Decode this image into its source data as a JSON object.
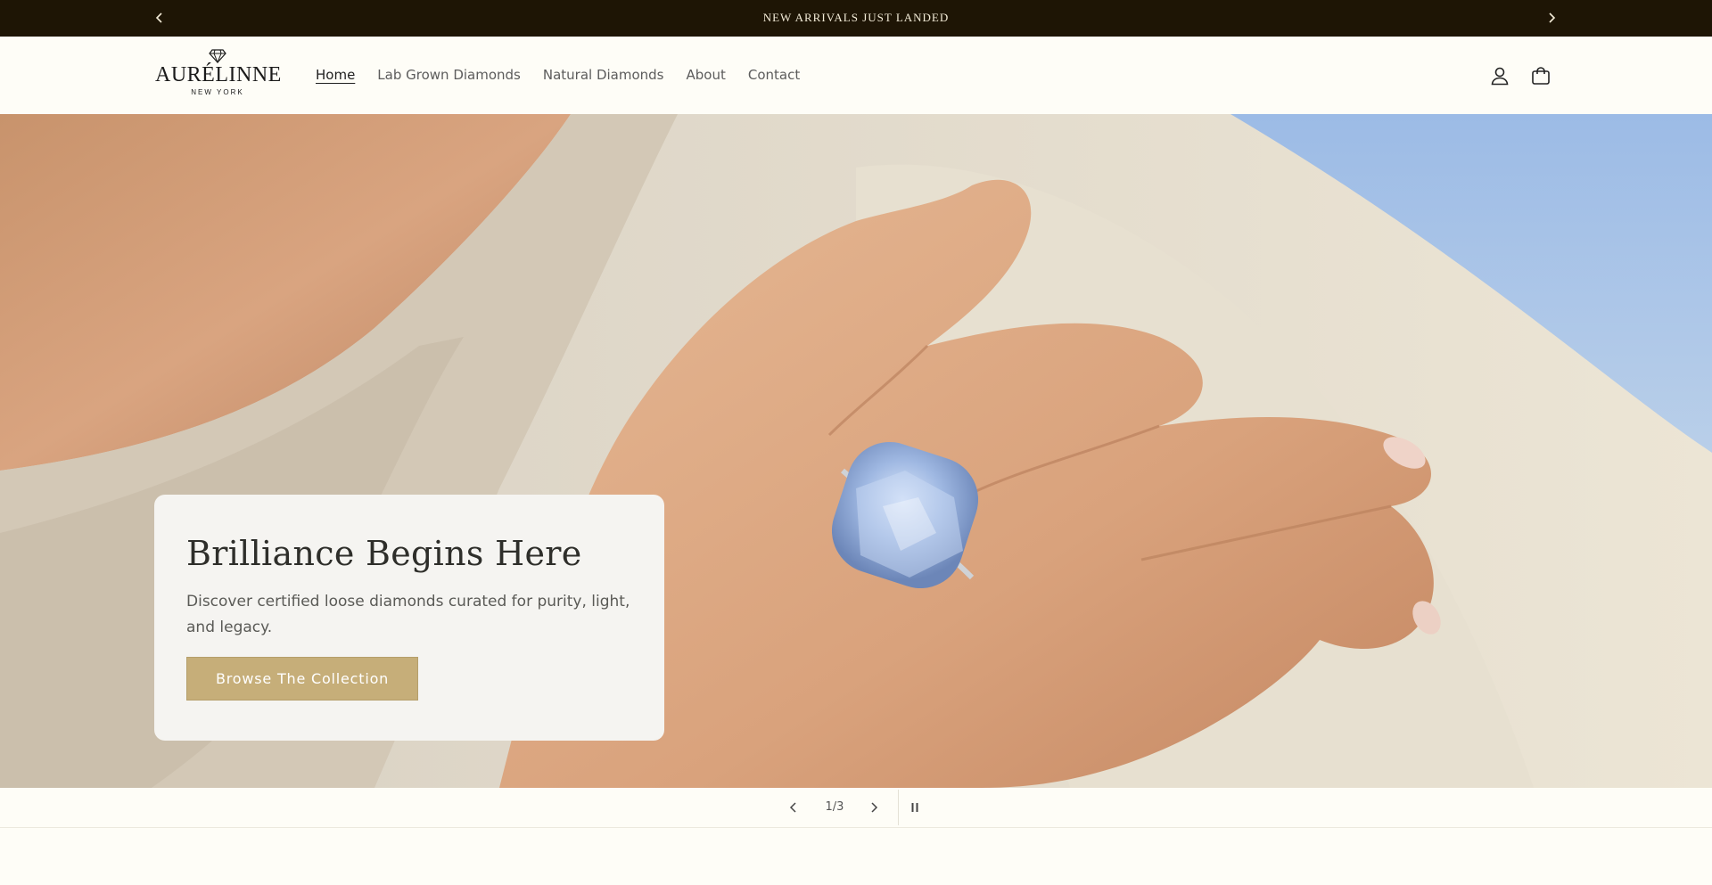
{
  "announcement": {
    "message": "NEW ARRIVALS JUST LANDED",
    "prev_icon": "chevron-left-icon",
    "next_icon": "chevron-right-icon"
  },
  "header": {
    "logo": {
      "brand": "AURÉLINNE",
      "subtitle": "NEW YORK",
      "icon": "diamond-icon"
    },
    "nav": [
      {
        "label": "Home",
        "active": true
      },
      {
        "label": "Lab Grown Diamonds",
        "active": false
      },
      {
        "label": "Natural Diamonds",
        "active": false
      },
      {
        "label": "About",
        "active": false
      },
      {
        "label": "Contact",
        "active": false
      }
    ],
    "account_icon": "user-icon",
    "cart_icon": "cart-icon"
  },
  "hero": {
    "heading": "Brilliance Begins Here",
    "text": "Discover certified loose diamonds curated for purity, light, and legacy.",
    "cta_label": "Browse The Collection",
    "image": "hand-with-blue-diamond-ring"
  },
  "slider": {
    "counter": "1/3",
    "prev_icon": "chevron-left-icon",
    "next_icon": "chevron-right-icon",
    "pause_icon": "pause-icon"
  },
  "colors": {
    "announcement_bg": "#1e1505",
    "page_bg": "#fefdf7",
    "accent": "#c6ae79",
    "card_bg": "#f5f4f1"
  }
}
